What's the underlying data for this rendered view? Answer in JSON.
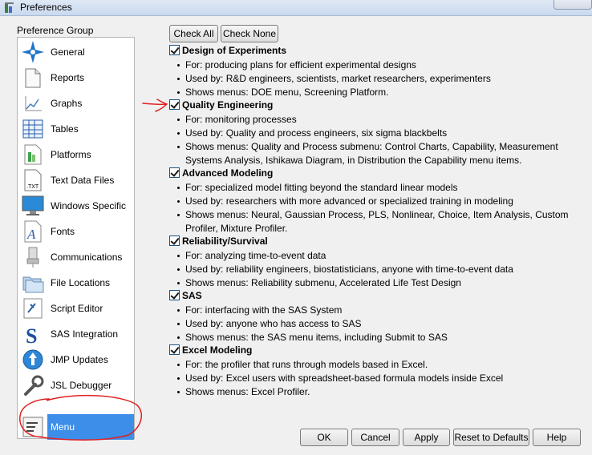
{
  "window": {
    "title": "Preferences"
  },
  "group_label": "Preference Group",
  "groups": [
    {
      "label": "General",
      "icon": "general-star-icon"
    },
    {
      "label": "Reports",
      "icon": "reports-icon"
    },
    {
      "label": "Graphs",
      "icon": "graphs-icon"
    },
    {
      "label": "Tables",
      "icon": "tables-icon"
    },
    {
      "label": "Platforms",
      "icon": "platforms-icon"
    },
    {
      "label": "Text Data Files",
      "icon": "txt-file-icon"
    },
    {
      "label": "Windows Specific",
      "icon": "monitor-icon"
    },
    {
      "label": "Fonts",
      "icon": "fonts-icon"
    },
    {
      "label": "Communications",
      "icon": "communications-icon"
    },
    {
      "label": "File Locations",
      "icon": "folders-icon"
    },
    {
      "label": "Script Editor",
      "icon": "script-editor-icon"
    },
    {
      "label": "SAS Integration",
      "icon": "sas-icon"
    },
    {
      "label": "JMP Updates",
      "icon": "jmp-updates-icon"
    },
    {
      "label": "JSL Debugger",
      "icon": "wrench-icon"
    },
    {
      "label": "Menu",
      "icon": "menu-icon",
      "selected": true
    }
  ],
  "top_buttons": {
    "check_all": "Check All",
    "check_none": "Check None"
  },
  "sections": [
    {
      "title": "Design of Experiments",
      "checked": true,
      "bullets": [
        "For: producing plans for efficient experimental designs",
        "Used by: R&D engineers, scientists, market researchers, experimenters",
        "Shows menus: DOE menu, Screening Platform."
      ]
    },
    {
      "title": "Quality Engineering",
      "checked": true,
      "bullets": [
        "For: monitoring processes",
        "Used by: Quality and process engineers, six sigma blackbelts",
        "Shows menus: Quality and Process submenu: Control Charts, Capability, Measurement Systems Analysis, Ishikawa Diagram, in Distribution the Capability menu items."
      ]
    },
    {
      "title": "Advanced Modeling",
      "checked": true,
      "bullets": [
        "For: specialized model fitting beyond the standard linear models",
        "Used by: researchers with more advanced or specialized training in modeling",
        "Shows menus: Neural, Gaussian Process, PLS, Nonlinear, Choice, Item Analysis, Custom Profiler, Mixture Profiler."
      ]
    },
    {
      "title": "Reliability/Survival",
      "checked": true,
      "bullets": [
        "For: analyzing time-to-event data",
        "Used by: reliability engineers, biostatisticians, anyone with time-to-event data",
        "Shows menus: Reliability submenu, Accelerated Life Test Design"
      ]
    },
    {
      "title": "SAS",
      "checked": true,
      "bullets": [
        "For: interfacing with the SAS System",
        "Used by: anyone who has access to SAS",
        "Shows menus: the SAS menu items, including Submit to SAS"
      ]
    },
    {
      "title": "Excel Modeling",
      "checked": true,
      "bullets": [
        "For: the profiler that runs through models based in Excel.",
        "Used by: Excel users with spreadsheet-based formula models inside Excel",
        "Shows menus: Excel Profiler."
      ]
    }
  ],
  "bottom_buttons": {
    "ok": "OK",
    "cancel": "Cancel",
    "apply": "Apply",
    "reset": "Reset to Defaults",
    "help": "Help"
  },
  "colors": {
    "selection": "#3d8ee8",
    "annotation": "#e02020"
  }
}
